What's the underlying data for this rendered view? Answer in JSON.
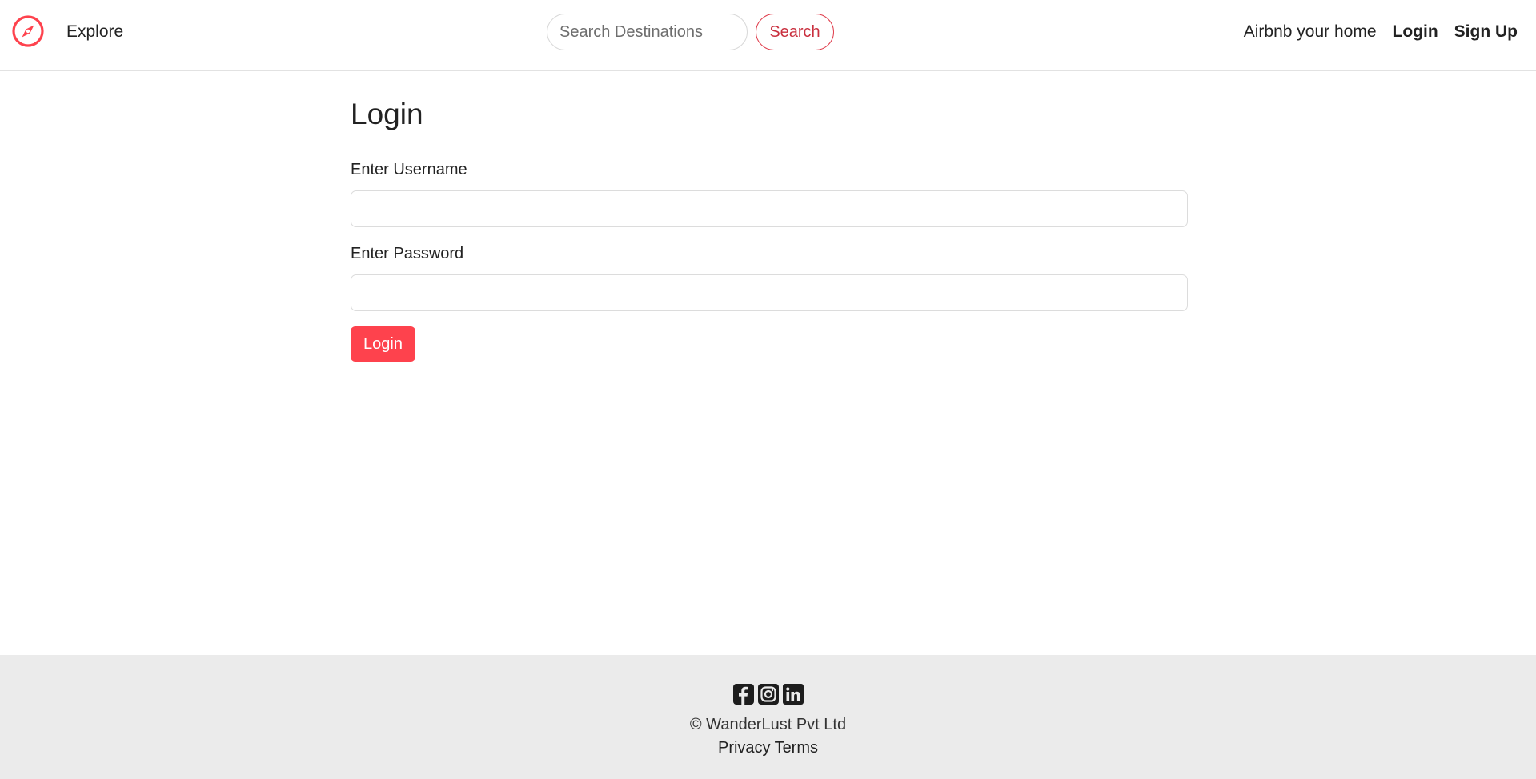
{
  "colors": {
    "brand": "#fe424d",
    "footer_bg": "#ebebeb"
  },
  "navbar": {
    "logo_icon": "compass-icon",
    "explore_label": "Explore",
    "search": {
      "placeholder": "Search Destinations",
      "value": "",
      "button_label": "Search"
    },
    "host_link": "Airbnb your home",
    "login_link": "Login",
    "signup_link": "Sign Up"
  },
  "main": {
    "title": "Login",
    "username_label": "Enter Username",
    "username_value": "",
    "password_label": "Enter Password",
    "password_value": "",
    "submit_label": "Login"
  },
  "footer": {
    "social_icons": [
      "facebook-icon",
      "instagram-icon",
      "linkedin-icon"
    ],
    "copyright": "© WanderLust Pvt Ltd",
    "privacy_link": "Privacy",
    "terms_link": "Terms"
  }
}
